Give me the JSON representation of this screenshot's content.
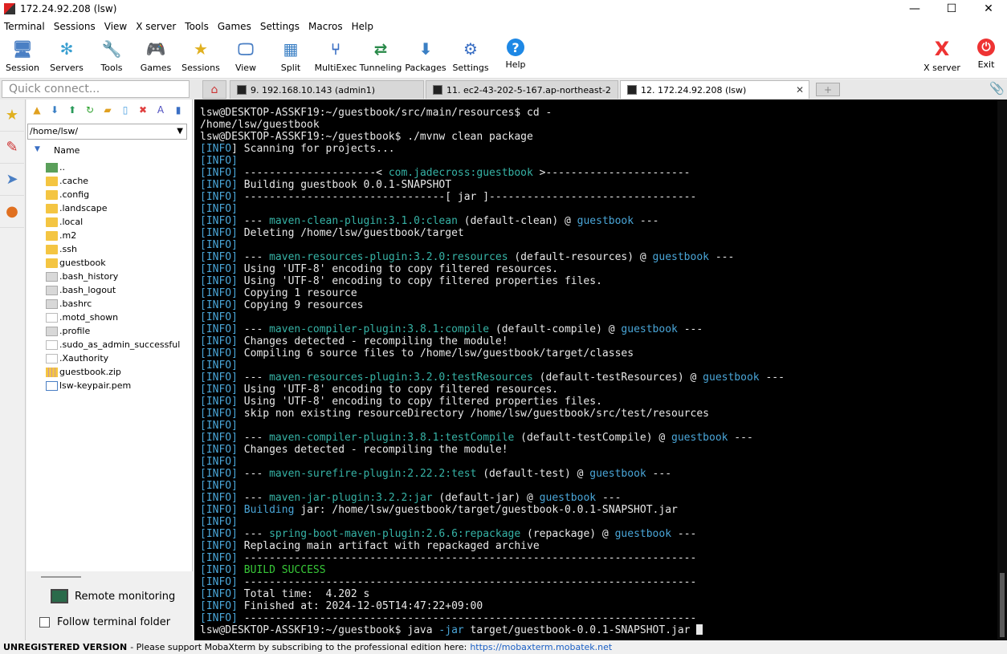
{
  "window": {
    "title": "172.24.92.208 (lsw)",
    "minimize": "—",
    "maximize": "☐",
    "close": "✕"
  },
  "menu": [
    "Terminal",
    "Sessions",
    "View",
    "X server",
    "Tools",
    "Games",
    "Settings",
    "Macros",
    "Help"
  ],
  "toolbar": [
    {
      "label": "Session",
      "icon": "session-icon",
      "glyph": "🖥"
    },
    {
      "label": "Servers",
      "icon": "servers-icon",
      "glyph": "✻"
    },
    {
      "label": "Tools",
      "icon": "tools-icon",
      "glyph": "🔧"
    },
    {
      "label": "Games",
      "icon": "games-icon",
      "glyph": "🎮"
    },
    {
      "label": "Sessions",
      "icon": "star-icon",
      "glyph": "★"
    },
    {
      "label": "View",
      "icon": "view-icon",
      "glyph": "🖵"
    },
    {
      "label": "Split",
      "icon": "split-icon",
      "glyph": "▦"
    },
    {
      "label": "MultiExec",
      "icon": "multiexec-icon",
      "glyph": "⑂"
    },
    {
      "label": "Tunneling",
      "icon": "tunneling-icon",
      "glyph": "⇄"
    },
    {
      "label": "Packages",
      "icon": "packages-icon",
      "glyph": "⬇"
    },
    {
      "label": "Settings",
      "icon": "settings-icon",
      "glyph": "⚙"
    },
    {
      "label": "Help",
      "icon": "help-icon",
      "glyph": "?"
    }
  ],
  "toolbar_right": [
    {
      "label": "X server",
      "icon": "x-server-icon",
      "glyph": "X"
    },
    {
      "label": "Exit",
      "icon": "exit-icon",
      "glyph": "⏻"
    }
  ],
  "quick_connect": "Quick connect...",
  "tabs": [
    {
      "label": "9. 192.168.10.143 (admin1)"
    },
    {
      "label": "11. ec2-43-202-5-167.ap-northeast-2"
    },
    {
      "label": "12. 172.24.92.208 (lsw)"
    }
  ],
  "file_panel": {
    "path": "/home/lsw/",
    "column": "Name",
    "files": [
      {
        "name": "..",
        "kind": "up"
      },
      {
        "name": ".cache",
        "kind": "folder"
      },
      {
        "name": ".config",
        "kind": "folder"
      },
      {
        "name": ".landscape",
        "kind": "folder"
      },
      {
        "name": ".local",
        "kind": "folder"
      },
      {
        "name": ".m2",
        "kind": "folder"
      },
      {
        "name": ".ssh",
        "kind": "folder"
      },
      {
        "name": "guestbook",
        "kind": "folder"
      },
      {
        "name": ".bash_history",
        "kind": "doc"
      },
      {
        "name": ".bash_logout",
        "kind": "doc"
      },
      {
        "name": ".bashrc",
        "kind": "doc"
      },
      {
        "name": ".motd_shown",
        "kind": "blank"
      },
      {
        "name": ".profile",
        "kind": "doc"
      },
      {
        "name": ".sudo_as_admin_successful",
        "kind": "blank"
      },
      {
        "name": ".Xauthority",
        "kind": "blank"
      },
      {
        "name": "guestbook.zip",
        "kind": "zip"
      },
      {
        "name": "lsw-keypair.pem",
        "kind": "pem"
      }
    ],
    "remote_monitoring": "Remote monitoring",
    "follow_terminal": "Follow terminal folder"
  },
  "terminal_lines": [
    [
      [
        "lsw@DESKTOP-ASSKF19:~/guestbook/src/main/resources$ cd -",
        ""
      ]
    ],
    [
      [
        "/home/lsw/guestbook",
        ""
      ]
    ],
    [
      [
        "lsw@DESKTOP-ASSKF19:~/guestbook$ ./mvnw clean package",
        ""
      ]
    ],
    [
      [
        "[",
        "b"
      ],
      [
        "INFO",
        "b"
      ],
      [
        "] Scanning for projects...",
        ""
      ]
    ],
    [
      [
        "[INFO]",
        "b"
      ]
    ],
    [
      [
        "[INFO]",
        "b"
      ],
      [
        " ---------------------< ",
        ""
      ],
      [
        "com.jadecross:guestbook",
        "g"
      ],
      [
        " >-----------------------",
        ""
      ]
    ],
    [
      [
        "[INFO]",
        "b"
      ],
      [
        " Building guestbook 0.0.1-SNAPSHOT",
        ""
      ]
    ],
    [
      [
        "[INFO]",
        "b"
      ],
      [
        " --------------------------------[ jar ]---------------------------------",
        ""
      ]
    ],
    [
      [
        "[INFO]",
        "b"
      ]
    ],
    [
      [
        "[INFO]",
        "b"
      ],
      [
        " --- ",
        ""
      ],
      [
        "maven-clean-plugin:3.1.0:clean",
        "g"
      ],
      [
        " (default-clean) @ ",
        ""
      ],
      [
        "guestbook",
        "b"
      ],
      [
        " ---",
        ""
      ]
    ],
    [
      [
        "[INFO]",
        "b"
      ],
      [
        " Deleting /home/lsw/guestbook/target",
        ""
      ]
    ],
    [
      [
        "[INFO]",
        "b"
      ]
    ],
    [
      [
        "[INFO]",
        "b"
      ],
      [
        " --- ",
        ""
      ],
      [
        "maven-resources-plugin:3.2.0:resources",
        "g"
      ],
      [
        " (default-resources) @ ",
        ""
      ],
      [
        "guestbook",
        "b"
      ],
      [
        " ---",
        ""
      ]
    ],
    [
      [
        "[INFO]",
        "b"
      ],
      [
        " Using 'UTF-8' encoding to copy filtered resources.",
        ""
      ]
    ],
    [
      [
        "[INFO]",
        "b"
      ],
      [
        " Using 'UTF-8' encoding to copy filtered properties files.",
        ""
      ]
    ],
    [
      [
        "[INFO]",
        "b"
      ],
      [
        " Copying 1 resource",
        ""
      ]
    ],
    [
      [
        "[INFO]",
        "b"
      ],
      [
        " Copying 9 resources",
        ""
      ]
    ],
    [
      [
        "[INFO]",
        "b"
      ]
    ],
    [
      [
        "[INFO]",
        "b"
      ],
      [
        " --- ",
        ""
      ],
      [
        "maven-compiler-plugin:3.8.1:compile",
        "g"
      ],
      [
        " (default-compile) @ ",
        ""
      ],
      [
        "guestbook",
        "b"
      ],
      [
        " ---",
        ""
      ]
    ],
    [
      [
        "[INFO]",
        "b"
      ],
      [
        " Changes detected - recompiling the module!",
        ""
      ]
    ],
    [
      [
        "[INFO]",
        "b"
      ],
      [
        " Compiling 6 source files to /home/lsw/guestbook/target/classes",
        ""
      ]
    ],
    [
      [
        "[INFO]",
        "b"
      ]
    ],
    [
      [
        "[INFO]",
        "b"
      ],
      [
        " --- ",
        ""
      ],
      [
        "maven-resources-plugin:3.2.0:testResources",
        "g"
      ],
      [
        " (default-testResources) @ ",
        ""
      ],
      [
        "guestbook",
        "b"
      ],
      [
        " ---",
        ""
      ]
    ],
    [
      [
        "[INFO]",
        "b"
      ],
      [
        " Using 'UTF-8' encoding to copy filtered resources.",
        ""
      ]
    ],
    [
      [
        "[INFO]",
        "b"
      ],
      [
        " Using 'UTF-8' encoding to copy filtered properties files.",
        ""
      ]
    ],
    [
      [
        "[INFO]",
        "b"
      ],
      [
        " skip non existing resourceDirectory /home/lsw/guestbook/src/test/resources",
        ""
      ]
    ],
    [
      [
        "[INFO]",
        "b"
      ]
    ],
    [
      [
        "[INFO]",
        "b"
      ],
      [
        " --- ",
        ""
      ],
      [
        "maven-compiler-plugin:3.8.1:testCompile",
        "g"
      ],
      [
        " (default-testCompile) @ ",
        ""
      ],
      [
        "guestbook",
        "b"
      ],
      [
        " ---",
        ""
      ]
    ],
    [
      [
        "[INFO]",
        "b"
      ],
      [
        " Changes detected - recompiling the module!",
        ""
      ]
    ],
    [
      [
        "[INFO]",
        "b"
      ]
    ],
    [
      [
        "[INFO]",
        "b"
      ],
      [
        " --- ",
        ""
      ],
      [
        "maven-surefire-plugin:2.22.2:test",
        "g"
      ],
      [
        " (default-test) @ ",
        ""
      ],
      [
        "guestbook",
        "b"
      ],
      [
        " ---",
        ""
      ]
    ],
    [
      [
        "[INFO]",
        "b"
      ]
    ],
    [
      [
        "[INFO]",
        "b"
      ],
      [
        " --- ",
        ""
      ],
      [
        "maven-jar-plugin:3.2.2:jar",
        "g"
      ],
      [
        " (default-jar) @ ",
        ""
      ],
      [
        "guestbook",
        "b"
      ],
      [
        " ---",
        ""
      ]
    ],
    [
      [
        "[INFO]",
        "b"
      ],
      [
        " ",
        ""
      ],
      [
        "Building",
        "b"
      ],
      [
        " jar: /home/lsw/guestbook/target/guestbook-0.0.1-SNAPSHOT.jar",
        ""
      ]
    ],
    [
      [
        "[INFO]",
        "b"
      ]
    ],
    [
      [
        "[INFO]",
        "b"
      ],
      [
        " --- ",
        ""
      ],
      [
        "spring-boot-maven-plugin:2.6.6:repackage",
        "g"
      ],
      [
        " (repackage) @ ",
        ""
      ],
      [
        "guestbook",
        "b"
      ],
      [
        " ---",
        ""
      ]
    ],
    [
      [
        "[INFO]",
        "b"
      ],
      [
        " Replacing main artifact with repackaged archive",
        ""
      ]
    ],
    [
      [
        "[INFO]",
        "b"
      ],
      [
        " ------------------------------------------------------------------------",
        ""
      ]
    ],
    [
      [
        "[INFO]",
        "b"
      ],
      [
        " ",
        ""
      ],
      [
        "BUILD SUCCESS",
        "gn"
      ]
    ],
    [
      [
        "[INFO]",
        "b"
      ],
      [
        " ------------------------------------------------------------------------",
        ""
      ]
    ],
    [
      [
        "[INFO]",
        "b"
      ],
      [
        " Total time:  4.202 s",
        ""
      ]
    ],
    [
      [
        "[INFO]",
        "b"
      ],
      [
        " Finished at: 2024-12-05T14:47:22+09:00",
        ""
      ]
    ],
    [
      [
        "[INFO]",
        "b"
      ],
      [
        " ------------------------------------------------------------------------",
        ""
      ]
    ],
    [
      [
        "lsw@DESKTOP-ASSKF19:~/guestbook$ java ",
        ""
      ],
      [
        "-jar",
        "b"
      ],
      [
        " target/guestbook-0.0.1-SNAPSHOT.jar ",
        ""
      ]
    ]
  ],
  "status": {
    "unregistered": "UNREGISTERED VERSION",
    "message": " -  Please support MobaXterm by subscribing to the professional edition here: ",
    "link": "https://mobaxterm.mobatek.net"
  }
}
